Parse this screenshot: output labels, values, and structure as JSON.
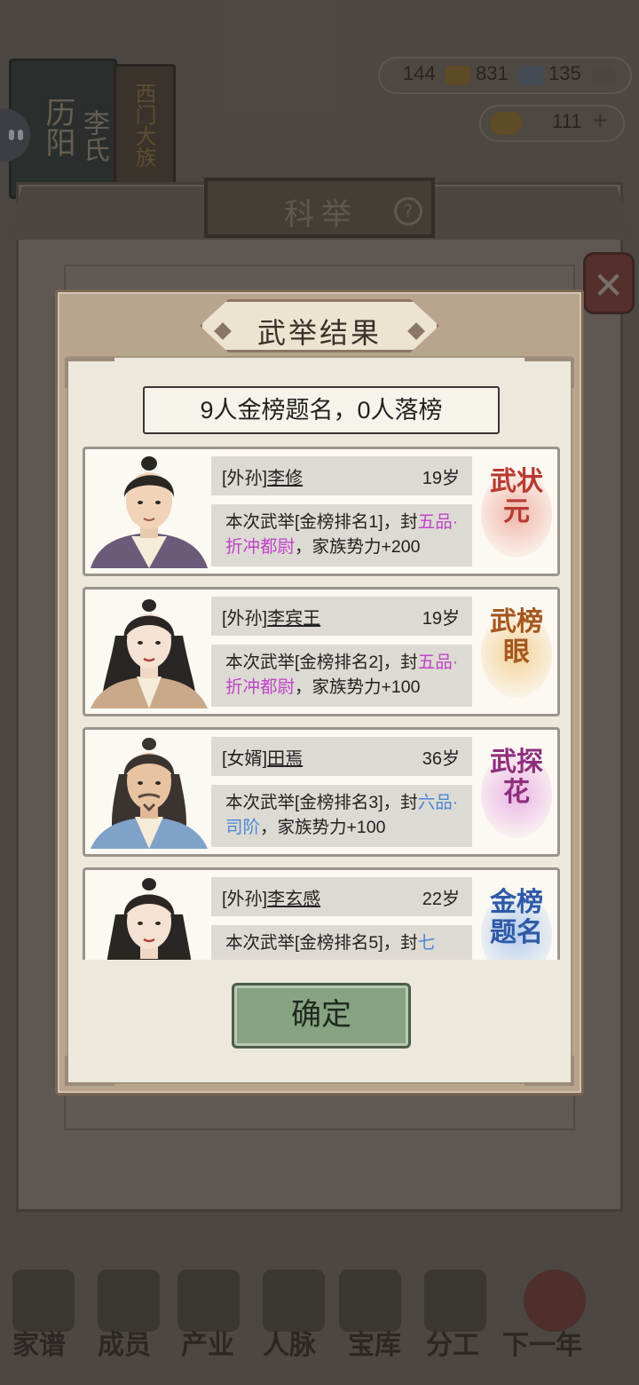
{
  "background": {
    "book_left_text": "历阳",
    "book_left_text2": "李氏",
    "book_right_text": "西门大族",
    "resources": {
      "r1": "144",
      "r2": "831",
      "r3": "135",
      "coins": "111"
    },
    "exam_window_title": "科举",
    "help_label": "?",
    "nav": [
      "家谱",
      "成员",
      "产业",
      "人脉",
      "宝库",
      "分工",
      "下一年"
    ]
  },
  "dialog": {
    "title": "武举结果",
    "summary": "9人金榜题名，0人落榜",
    "confirm_label": "确定",
    "results": [
      {
        "relation": "[外孙]",
        "name": "李修",
        "age": "19岁",
        "desc_pre": "本次武举[金榜排名1]，封",
        "rank_title": "五品·折冲都尉",
        "rank_color": "pink",
        "desc_post": "，家族势力+200",
        "badge": "武状元",
        "badge_color": "#b83a32",
        "badge_glow": "#f0b6ab"
      },
      {
        "relation": "[外孙]",
        "name": "李宾王",
        "age": "19岁",
        "desc_pre": "本次武举[金榜排名2]，封",
        "rank_title": "五品·折冲都尉",
        "rank_color": "pink",
        "desc_post": "，家族势力+100",
        "badge": "武榜眼",
        "badge_color": "#a5561e",
        "badge_glow": "#f3d29a"
      },
      {
        "relation": "[女婿]",
        "name": "田焉",
        "age": "36岁",
        "desc_pre": "本次武举[金榜排名3]，封",
        "rank_title": "六品·司阶",
        "rank_color": "blue",
        "desc_post": "，家族势力+100",
        "badge": "武探花",
        "badge_color": "#8e2f7d",
        "badge_glow": "#eab6e6"
      },
      {
        "relation": "[外孙]",
        "name": "李玄感",
        "age": "22岁",
        "desc_pre": "本次武举[金榜排名5]，封",
        "rank_title": "七",
        "rank_color": "blue",
        "desc_post": "",
        "badge": "金榜题名",
        "badge_color": "#2e5aa8",
        "badge_glow": "#b7cdee"
      }
    ]
  }
}
